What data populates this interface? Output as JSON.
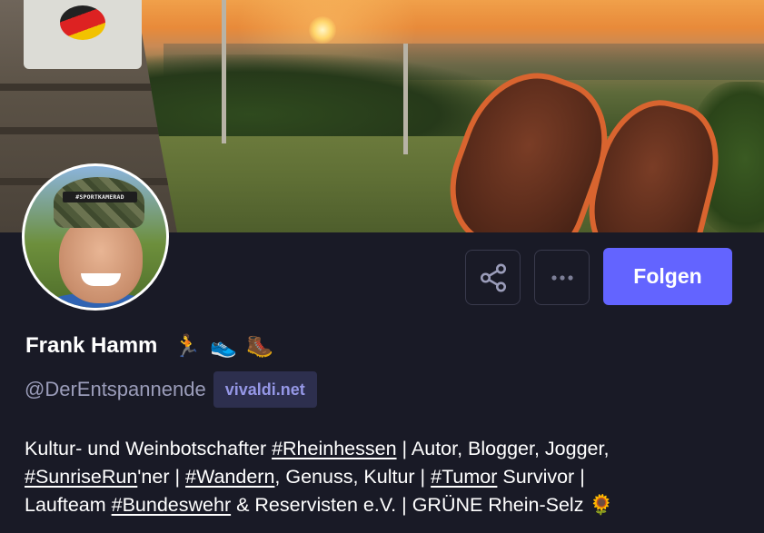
{
  "profile": {
    "display_name": "Frank Hamm",
    "name_emojis": {
      "runner": "🏃",
      "running_shoe": "👟",
      "hiking_boot": "🥾"
    },
    "handle": "@DerEntspannende",
    "domain": "vivaldi.net",
    "avatar_cap_text": "#SPORTKAMERAD",
    "banner_sign_text": ""
  },
  "actions": {
    "share_icon": "share-icon",
    "more_icon": "more-icon",
    "follow_label": "Folgen"
  },
  "bio": {
    "line1_pre": "Kultur- und Weinbotschafter ",
    "tag_rheinhessen": "#Rheinhessen",
    "line1_post": " | Autor, Blogger, Jogger,",
    "tag_sunriserun": "#SunriseRun",
    "line2_a": "'ner | ",
    "tag_wandern": "#Wandern",
    "line2_b": ", Genuss, Kultur | ",
    "tag_tumor": "#Tumor",
    "line2_c": " Survivor |",
    "line3_pre": "Laufteam ",
    "tag_bundeswehr": "#Bundeswehr",
    "line3_post": " & Reservisten e.V. | GRÜNE Rhein-Selz ",
    "sunflower": "🌻"
  },
  "colors": {
    "background": "#191a26",
    "accent": "#6364ff",
    "badge_bg": "#2d2f4e",
    "badge_text": "#9597e6",
    "handle_text": "#9b9dba"
  }
}
